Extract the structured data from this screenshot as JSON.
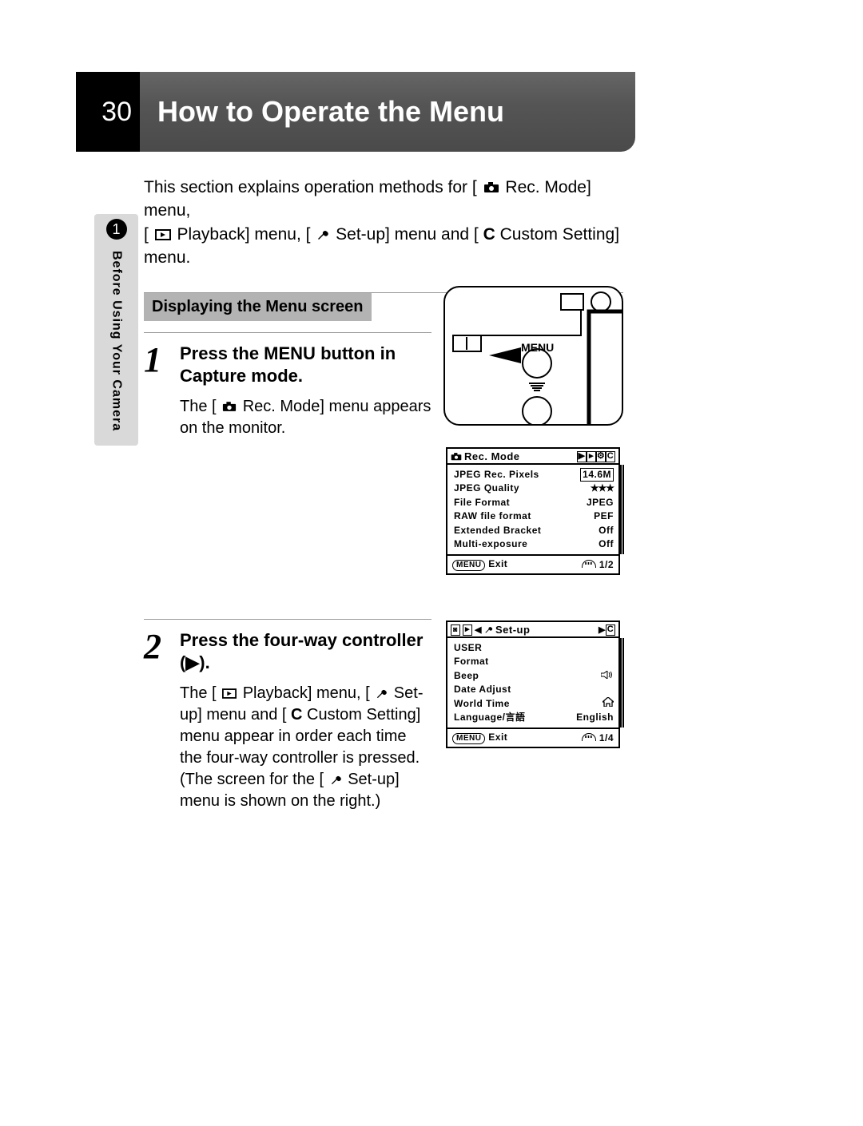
{
  "page_number": "30",
  "title": "How to Operate the Menu",
  "side_tab": {
    "chapter_number": "1",
    "chapter_label": "Before Using Your Camera"
  },
  "intro_line1_a": "This section explains operation methods for [",
  "intro_line1_b": " Rec. Mode] menu,",
  "intro_line2_a": "[",
  "intro_line2_b": " Playback] menu, [",
  "intro_line2_c": " Set-up] menu and [",
  "intro_line2_d": " Custom Setting] menu.",
  "custom_C": "C",
  "subheading": "Displaying the Menu screen",
  "steps": [
    {
      "num": "1",
      "title_a": "Press the ",
      "title_menu": "MENU",
      "title_b": " button in Capture mode.",
      "desc_a": "The [",
      "desc_b": " Rec. Mode] menu appears on the monitor."
    },
    {
      "num": "2",
      "title": "Press the four-way controller (▶).",
      "desc_a": "The [",
      "desc_b": " Playback] menu, [",
      "desc_c": " Set-up] menu and [",
      "desc_d": " Custom Setting] menu appear in order each time the four-way controller is pressed. (The screen for the [",
      "desc_e": " Set-up] menu is shown on the right.)"
    }
  ],
  "camera_button_label": "MENU",
  "rec_screen": {
    "header_title": "Rec. Mode",
    "rows": [
      {
        "label": "JPEG Rec. Pixels",
        "value": "14.6M"
      },
      {
        "label": "JPEG Quality",
        "value": "★★★"
      },
      {
        "label": "File Format",
        "value": "JPEG"
      },
      {
        "label": "RAW file format",
        "value": "PEF"
      },
      {
        "label": "Extended Bracket",
        "value": "Off"
      },
      {
        "label": "Multi-exposure",
        "value": "Off"
      }
    ],
    "footer_exit": "Exit",
    "footer_btn": "MENU",
    "footer_page": "1/2"
  },
  "setup_screen": {
    "header_title": "Set-up",
    "rows": [
      {
        "label": "USER",
        "value": ""
      },
      {
        "label": "Format",
        "value": ""
      },
      {
        "label": "Beep",
        "value": "🔊"
      },
      {
        "label": "Date Adjust",
        "value": ""
      },
      {
        "label": "World Time",
        "value": "⌂"
      },
      {
        "label": "Language/言語",
        "value": "English"
      }
    ],
    "footer_exit": "Exit",
    "footer_btn": "MENU",
    "footer_page": "1/4",
    "tab_C": "C"
  }
}
